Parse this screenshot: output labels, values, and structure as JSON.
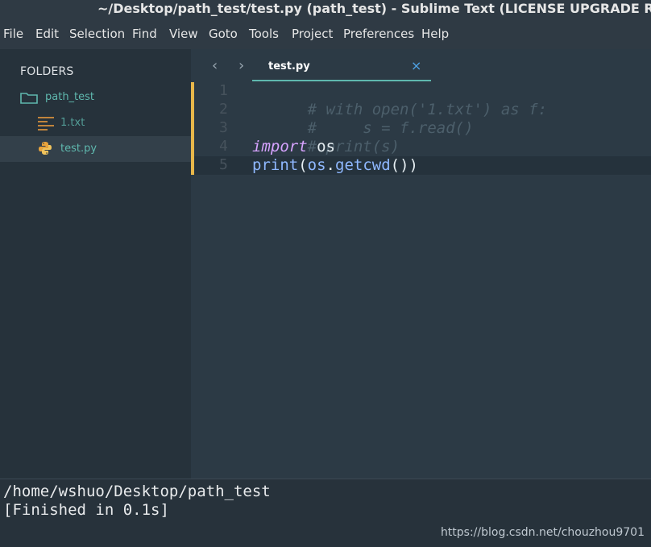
{
  "window": {
    "title": "~/Desktop/path_test/test.py (path_test) - Sublime Text (LICENSE UPGRADE REQUIRED)"
  },
  "menu": [
    "File",
    "Edit",
    "Selection",
    "Find",
    "View",
    "Goto",
    "Tools",
    "Project",
    "Preferences",
    "Help"
  ],
  "sidebar": {
    "header": "FOLDERS",
    "folder": {
      "name": "path_test",
      "icon": "folder-icon"
    },
    "files": [
      {
        "name": "1.txt",
        "icon": "text-file-icon",
        "selected": false
      },
      {
        "name": "test.py",
        "icon": "python-icon",
        "selected": true
      }
    ]
  },
  "tabs": [
    {
      "label": "test.py",
      "close": "×",
      "active": true
    }
  ],
  "editor": {
    "line_numbers": [
      "1",
      "2",
      "3",
      "4",
      "5"
    ],
    "code": {
      "l1": "# with open('1.txt') as f:",
      "l2": "#     s = f.read()",
      "l3": "# print(s)",
      "l4_kw": "import",
      "l4_rest": " os",
      "l5_print": "print",
      "l5_open": "(",
      "l5_os": "os",
      "l5_dot": ".",
      "l5_fn": "getcwd",
      "l5_close": "())"
    }
  },
  "output": {
    "line1": "/home/wshuo/Desktop/path_test",
    "line2": "[Finished in 0.1s]"
  },
  "watermark": "https://blog.csdn.net/chouzhou9701",
  "colors": {
    "accent": "#5fb8ae",
    "keyword": "#d7a3ff",
    "function": "#8fb8ff",
    "comment": "#4c5f6b",
    "gutter_marker": "#e8b74a"
  }
}
